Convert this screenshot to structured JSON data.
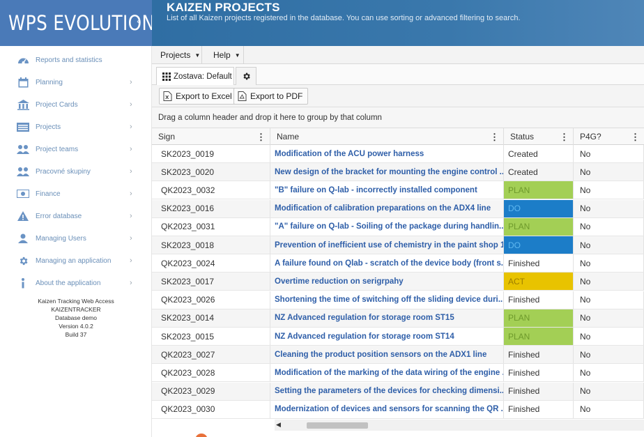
{
  "brand": {
    "logo": "WPS EVOLUTION",
    "collapse_glyph": "‹"
  },
  "header": {
    "title": "KAIZEN PROJECTS",
    "subtitle": "List of all Kaizen projects registered in the database. You can use sorting or advanced filtering to search."
  },
  "sidebar": {
    "items": [
      {
        "label": "Reports and statistics",
        "icon": "dashboard-icon",
        "has_chevron": false
      },
      {
        "label": "Planning",
        "icon": "calendar-icon",
        "has_chevron": true
      },
      {
        "label": "Project Cards",
        "icon": "building-icon",
        "has_chevron": true
      },
      {
        "label": "Projects",
        "icon": "list-icon",
        "has_chevron": true
      },
      {
        "label": "Project teams",
        "icon": "users-icon",
        "has_chevron": true
      },
      {
        "label": "Pracovné skupiny",
        "icon": "users-icon",
        "has_chevron": true
      },
      {
        "label": "Finance",
        "icon": "money-icon",
        "has_chevron": true
      },
      {
        "label": "Error database",
        "icon": "warning-icon",
        "has_chevron": true
      },
      {
        "label": "Managing Users",
        "icon": "user-icon",
        "has_chevron": true
      },
      {
        "label": "Managing an application",
        "icon": "gear-icon",
        "has_chevron": true
      },
      {
        "label": "About the application",
        "icon": "info-icon",
        "has_chevron": true
      }
    ],
    "chevron": "›",
    "info": {
      "line1": "Kaizen Tracking Web Access",
      "line2": "KAIZENTRACKER",
      "line3": "Database demo",
      "line4": "Version 4.0.2",
      "line5": "Build 37"
    }
  },
  "menubar": {
    "projects": "Projects",
    "help": "Help",
    "caret": "▼"
  },
  "tabs": {
    "active_label": "Zostava: Default"
  },
  "toolbar": {
    "excel": "Export to Excel",
    "pdf": "Export to PDF"
  },
  "group_panel": {
    "text": "Drag a column header and drop it here to group by that column"
  },
  "grid": {
    "columns": {
      "sign": "Sign",
      "name": "Name",
      "status": "Status",
      "p4g": "P4G?"
    },
    "kebab": "⋮",
    "rows": [
      {
        "sign": "SK2023_0019",
        "name": "Modification of the ACU power harness",
        "status": "Created",
        "status_color": "",
        "p4g": "No"
      },
      {
        "sign": "SK2023_0020",
        "name": "New design of the bracket for mounting the engine control ...",
        "status": "Created",
        "status_color": "",
        "p4g": "No"
      },
      {
        "sign": "QK2023_0032",
        "name": "\"B\" failure on Q-lab - incorrectly installed component",
        "status": "PLAN",
        "status_color": "#a3cf55",
        "p4g": "No"
      },
      {
        "sign": "SK2023_0016",
        "name": "Modification of calibration preparations on the ADX4 line",
        "status": "DO",
        "status_color": "#1c7dc8",
        "p4g": "No"
      },
      {
        "sign": "QK2023_0031",
        "name": "\"A\" failure on Q-lab - Soiling of the package during handlin...",
        "status": "PLAN",
        "status_color": "#a3cf55",
        "p4g": "No"
      },
      {
        "sign": "SK2023_0018",
        "name": "Prevention of inefficient use of chemistry in the paint shop 1",
        "status": "DO",
        "status_color": "#1c7dc8",
        "p4g": "No"
      },
      {
        "sign": "QK2023_0024",
        "name": "A failure found on Qlab - scratch of the device body (front s...",
        "status": "Finished",
        "status_color": "",
        "p4g": "No"
      },
      {
        "sign": "SK2023_0017",
        "name": "Overtime reduction on serigrpahy",
        "status": "ACT",
        "status_color": "#e8c300",
        "p4g": "No"
      },
      {
        "sign": "QK2023_0026",
        "name": "Shortening the time of switching off the sliding device duri...",
        "status": "Finished",
        "status_color": "",
        "p4g": "No"
      },
      {
        "sign": "SK2023_0014",
        "name": "NZ Advanced regulation for storage room ST15",
        "status": "PLAN",
        "status_color": "#a3cf55",
        "p4g": "No"
      },
      {
        "sign": "SK2023_0015",
        "name": "NZ Advanced regulation for storage room ST14",
        "status": "PLAN",
        "status_color": "#a3cf55",
        "p4g": "No"
      },
      {
        "sign": "QK2023_0027",
        "name": "Cleaning the product position sensors on the ADX1 line",
        "status": "Finished",
        "status_color": "",
        "p4g": "No"
      },
      {
        "sign": "QK2023_0028",
        "name": "Modification of the marking of the data wiring of the engine ...",
        "status": "Finished",
        "status_color": "",
        "p4g": "No"
      },
      {
        "sign": "QK2023_0029",
        "name": "Setting the parameters of the devices for checking dimensi...",
        "status": "Finished",
        "status_color": "",
        "p4g": "No"
      },
      {
        "sign": "QK2023_0030",
        "name": "Modernization of devices and sensors for scanning the QR ...",
        "status": "Finished",
        "status_color": "",
        "p4g": "No"
      }
    ]
  },
  "colors": {
    "brand_blue": "#4a7ab8",
    "header_blue": "#2f6ea3",
    "link_blue": "#2e5ea8",
    "plan_green": "#a3cf55",
    "do_blue": "#1c7dc8",
    "act_yellow": "#e8c300"
  }
}
